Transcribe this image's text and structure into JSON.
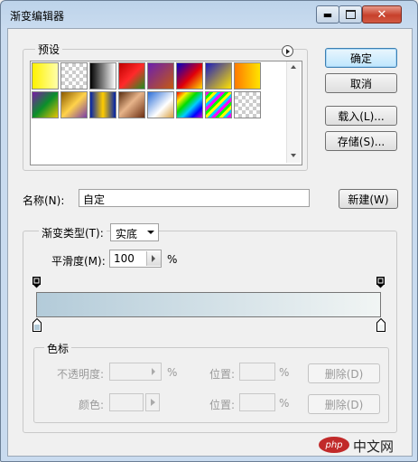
{
  "window": {
    "title": "渐变编辑器"
  },
  "presets": {
    "label": "预设",
    "swatches": [
      "linear-gradient(90deg,#fff200,#ffffaa)",
      "checker-white",
      "linear-gradient(90deg,#000,#fff)",
      "linear-gradient(135deg,#c00000,#ff2a2a 50%,#1f8f1f)",
      "linear-gradient(135deg,#6a1fb0,#c65a10)",
      "linear-gradient(135deg,#0000c8,#e0000a 55%,#ffdd00)",
      "linear-gradient(135deg,#1c1cbe,#ffe300)",
      "linear-gradient(90deg,#ff7a00,#ffe400)",
      "linear-gradient(135deg,#7a1aa8,#0a8f2a 50%,#e8c400)",
      "linear-gradient(135deg,#8b5a00,#ffd24a 50%,#7a3ea8)",
      "linear-gradient(90deg,#0022aa,#ffcc00 50%,#0022aa)",
      "linear-gradient(135deg,#5a2e10,#e7b48a 45%,#6b2e12)",
      "linear-gradient(135deg,#2b6ed8,#ffffff 60%,#d8a040)",
      "linear-gradient(135deg,#ff0000,#ffee00,#00dd00,#00ccff,#0000ff,#cc00cc)",
      "repeating-linear-gradient(135deg,#ff00ff 0 3px,#00ff00 3px 6px,#ffff00 6px 9px,#00ccff 9px 12px)",
      "checker-stripes"
    ]
  },
  "buttons": {
    "ok": "确定",
    "cancel": "取消",
    "load": "载入(L)...",
    "save": "存储(S)...",
    "new": "新建(W)"
  },
  "name": {
    "label": "名称(N):",
    "value": "自定"
  },
  "gradient": {
    "type_label": "渐变类型(T):",
    "type_value": "实底",
    "smooth_label": "平滑度(M):",
    "smooth_value": "100",
    "percent": "%",
    "start_color": "#b3cbd9",
    "end_color": "#f1f5f4"
  },
  "color_stops": {
    "label": "色标",
    "opacity_label": "不透明度:",
    "opacity_pct": "%",
    "position_label": "位置:",
    "position_pct": "%",
    "delete_label": "删除(D)",
    "color_label": "颜色:",
    "position2_label": "位置:",
    "position2_pct": "%",
    "delete2_label": "删除(D)"
  },
  "watermark": {
    "text": "中文网",
    "logo": "php"
  }
}
